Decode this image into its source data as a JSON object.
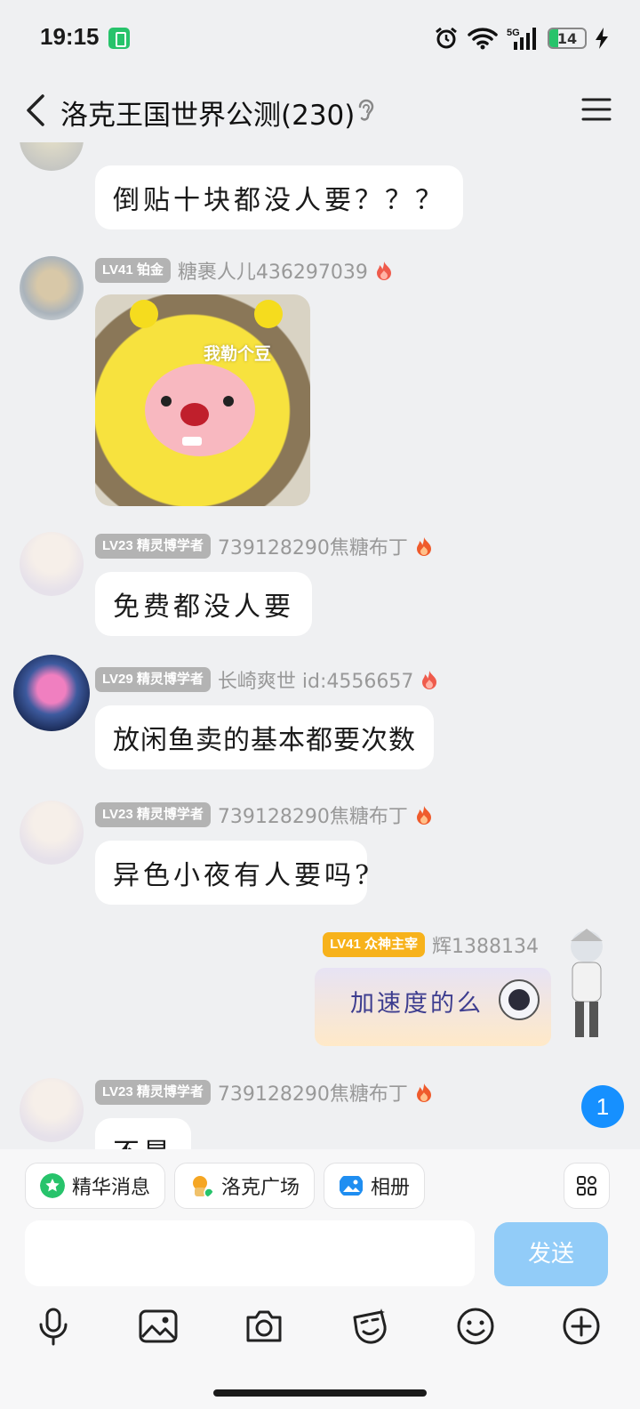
{
  "status_bar": {
    "time": "19:15",
    "battery": "14"
  },
  "header": {
    "title": "洛克王国世界公测(230)"
  },
  "messages": [
    {
      "text": "倒贴十块都没人要？？？"
    },
    {
      "level": "LV41 铂金",
      "name": "糖裹人儿436297039",
      "sticker_text": "我勒个豆"
    },
    {
      "level": "LV23 精灵博学者",
      "name": "739128290焦糖布丁",
      "text": "免费都没人要"
    },
    {
      "level": "LV29 精灵博学者",
      "name": "长崎爽世 id:4556657",
      "text": "放闲鱼卖的基本都要次数"
    },
    {
      "level": "LV23 精灵博学者",
      "name": "739128290焦糖布丁",
      "text": "异色小夜有人要吗?"
    },
    {
      "level": "LV41 众神主宰",
      "name": "辉1388134",
      "sticker_text": "加速度的么"
    },
    {
      "level": "LV23 精灵博学者",
      "name": "739128290焦糖布丁",
      "text": "不是"
    }
  ],
  "unread_count": "1",
  "shortcuts": [
    {
      "label": "精华消息",
      "icon": "star-icon",
      "color": "#27c36b"
    },
    {
      "label": "洛克广场",
      "icon": "roco-plaza-icon",
      "color": "#f5a623"
    },
    {
      "label": "相册",
      "icon": "album-icon",
      "color": "#1f8ef1"
    }
  ],
  "composer": {
    "send_label": "发送",
    "placeholder": ""
  },
  "toolbar_icons": [
    "mic-icon",
    "image-icon",
    "camera-icon",
    "sticker-face-icon",
    "emoji-icon",
    "plus-icon"
  ],
  "colors": {
    "accent": "#1690ff",
    "send_disabled": "#92ccf8",
    "badge_gold": "#f7b21b",
    "badge_grey": "#b3b3b3"
  }
}
